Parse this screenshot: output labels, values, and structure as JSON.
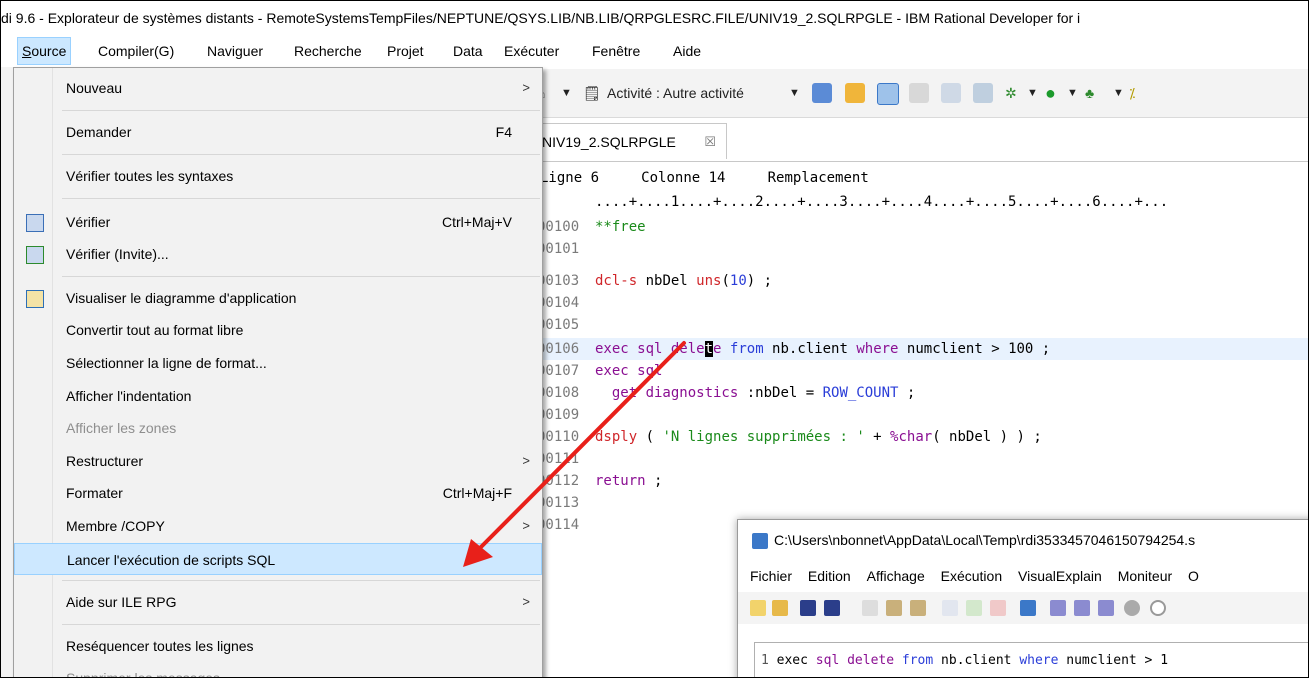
{
  "window_title": "di 9.6 - Explorateur de systèmes distants - RemoteSystemsTempFiles/NEPTUNE/QSYS.LIB/NB.LIB/QRPGLESRC.FILE/UNIV19_2.SQLRPGLE - IBM Rational Developer for i",
  "menubar": [
    "Source",
    "Compiler(G)",
    "Naviguer",
    "Recherche",
    "Projet",
    "Data",
    "Exécuter",
    "Fenêtre",
    "Aide"
  ],
  "toolbar": {
    "activity_label": "Activité : Autre activité"
  },
  "editor_tab": {
    "label": "NIV19_2.SQLRPGLE",
    "close": "☒"
  },
  "status": {
    "line": "Ligne 6",
    "column": "Colonne 14",
    "mode": "Remplacement"
  },
  "ruler": "....+....1....+....2....+....3....+....4....+....5....+....6....+...",
  "code_lines": [
    {
      "num": "00100",
      "text": "**free"
    },
    {
      "num": "00101",
      "text": ""
    },
    {
      "num": "00103",
      "text": "dcl-s nbDel uns(10) ;"
    },
    {
      "num": "00104",
      "text": ""
    },
    {
      "num": "00105",
      "text": ""
    },
    {
      "num": "00106",
      "text": "exec sql delete from nb.client where numclient > 100 ;"
    },
    {
      "num": "00107",
      "text": "exec sql"
    },
    {
      "num": "00108",
      "text": "  get diagnostics :nbDel = ROW_COUNT ;"
    },
    {
      "num": "00109",
      "text": ""
    },
    {
      "num": "00110",
      "text": "dsply ( 'N lignes supprimées : ' + %char( nbDel ) ) ;"
    },
    {
      "num": "00111",
      "text": ""
    },
    {
      "num": "00112",
      "text": "return ;"
    },
    {
      "num": "00113",
      "text": ""
    },
    {
      "num": "00114",
      "text": ""
    }
  ],
  "source_menu": [
    {
      "label": "Nouveau",
      "shortcut": "",
      "submenu": true
    },
    {
      "label": "Demander",
      "shortcut": "F4"
    },
    {
      "label": "Vérifier toutes les syntaxes",
      "shortcut": ""
    },
    {
      "label": "Vérifier",
      "shortcut": "Ctrl+Maj+V"
    },
    {
      "label": "Vérifier (Invite)...",
      "shortcut": ""
    },
    {
      "label": "Visualiser le diagramme d'application",
      "shortcut": ""
    },
    {
      "label": "Convertir tout au format libre",
      "shortcut": ""
    },
    {
      "label": "Sélectionner la ligne de format...",
      "shortcut": ""
    },
    {
      "label": "Afficher l'indentation",
      "shortcut": ""
    },
    {
      "label": "Afficher les zones",
      "shortcut": "",
      "disabled": true
    },
    {
      "label": "Restructurer",
      "shortcut": "",
      "submenu": true
    },
    {
      "label": "Formater",
      "shortcut": "Ctrl+Maj+F"
    },
    {
      "label": "Membre /COPY",
      "shortcut": "",
      "submenu": true
    },
    {
      "label": "Lancer l'exécution de scripts SQL",
      "shortcut": "",
      "selected": true
    },
    {
      "label": "Aide sur ILE RPG",
      "shortcut": "",
      "submenu": true
    },
    {
      "label": "Reséquencer toutes les lignes",
      "shortcut": ""
    },
    {
      "label": "Supprimer les messages",
      "shortcut": "",
      "disabled": true
    }
  ],
  "sql_window": {
    "title": "C:\\Users\\nbonnet\\AppData\\Local\\Temp\\rdi3533457046150794254.s",
    "menu": [
      "Fichier",
      "Edition",
      "Affichage",
      "Exécution",
      "VisualExplain",
      "Moniteur",
      "O"
    ],
    "line_num": "1",
    "sql_text": "exec sql delete from nb.client where numclient > 1"
  },
  "colors": {
    "accent": "#cde8ff",
    "keyword": "#8a0f92",
    "builtin": "#2a3dd8",
    "string": "#1a8a1a",
    "arrow": "#e8201a"
  }
}
